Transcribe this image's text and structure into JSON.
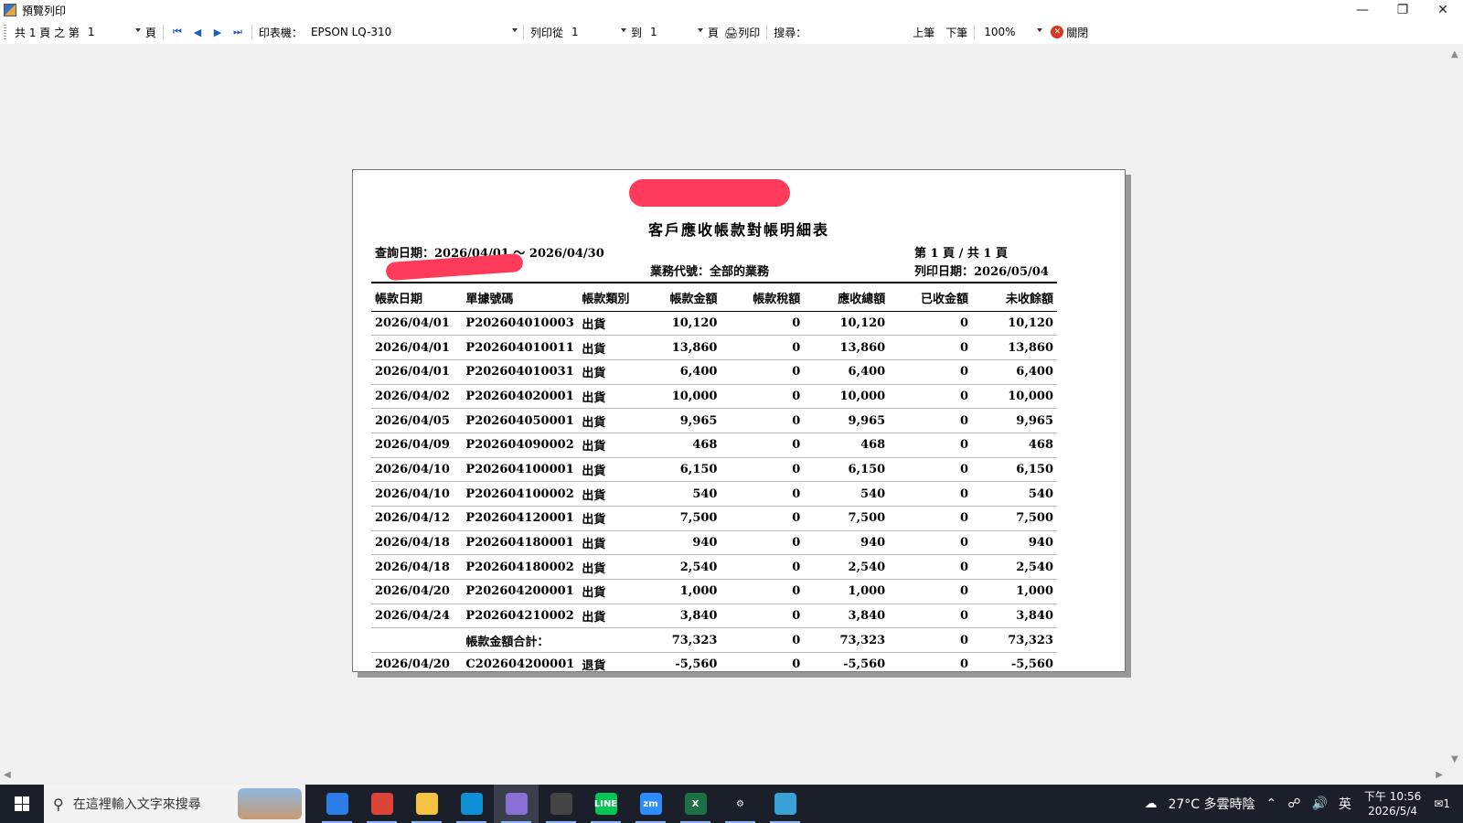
{
  "window": {
    "title": "預覽列印"
  },
  "toolbar": {
    "page_prefix": "共 1 頁 之 第",
    "page_value": "1",
    "page_suffix": "頁",
    "printer_label": "印表機：",
    "printer_value": "EPSON LQ-310",
    "print_from_label": "列印從",
    "print_from_value": "1",
    "to_label": "到",
    "to_value": "1",
    "to_suffix": "頁",
    "print_label": "列印",
    "search_label": "搜尋：",
    "search_value": "",
    "prev_label": "上筆",
    "next_label": "下筆",
    "zoom_value": "100%",
    "close_label": "關閉"
  },
  "report": {
    "title": "客戶應收帳款對帳明細表",
    "query_date": "查詢日期：2026/04/01 ～ 2026/04/30",
    "salesperson": "業務代號：全部的業務",
    "page_info": "第 1 頁 / 共 1 頁",
    "print_date": "列印日期：2026/05/04",
    "columns": [
      "帳款日期",
      "單據號碼",
      "帳款類別",
      "帳款金額",
      "帳款稅額",
      "應收總額",
      "已收金額",
      "未收餘額"
    ],
    "rows": [
      [
        "2026/04/01",
        "P202604010003",
        "出貨",
        "10,120",
        "0",
        "10,120",
        "0",
        "10,120"
      ],
      [
        "2026/04/01",
        "P202604010011",
        "出貨",
        "13,860",
        "0",
        "13,860",
        "0",
        "13,860"
      ],
      [
        "2026/04/01",
        "P202604010031",
        "出貨",
        "6,400",
        "0",
        "6,400",
        "0",
        "6,400"
      ],
      [
        "2026/04/02",
        "P202604020001",
        "出貨",
        "10,000",
        "0",
        "10,000",
        "0",
        "10,000"
      ],
      [
        "2026/04/05",
        "P202604050001",
        "出貨",
        "9,965",
        "0",
        "9,965",
        "0",
        "9,965"
      ],
      [
        "2026/04/09",
        "P202604090002",
        "出貨",
        "468",
        "0",
        "468",
        "0",
        "468"
      ],
      [
        "2026/04/10",
        "P202604100001",
        "出貨",
        "6,150",
        "0",
        "6,150",
        "0",
        "6,150"
      ],
      [
        "2026/04/10",
        "P202604100002",
        "出貨",
        "540",
        "0",
        "540",
        "0",
        "540"
      ],
      [
        "2026/04/12",
        "P202604120001",
        "出貨",
        "7,500",
        "0",
        "7,500",
        "0",
        "7,500"
      ],
      [
        "2026/04/18",
        "P202604180001",
        "出貨",
        "940",
        "0",
        "940",
        "0",
        "940"
      ],
      [
        "2026/04/18",
        "P202604180002",
        "出貨",
        "2,540",
        "0",
        "2,540",
        "0",
        "2,540"
      ],
      [
        "2026/04/20",
        "P202604200001",
        "出貨",
        "1,000",
        "0",
        "1,000",
        "0",
        "1,000"
      ],
      [
        "2026/04/24",
        "P202604210002",
        "出貨",
        "3,840",
        "0",
        "3,840",
        "0",
        "3,840"
      ]
    ],
    "subtotal": {
      "label": "帳款金額合計：",
      "amount": "73,323",
      "tax": "0",
      "total": "73,323",
      "received": "0",
      "balance": "73,323"
    },
    "partial_row": [
      "2026/04/20",
      "C202604200001",
      "退貨",
      "-5,560",
      "0",
      "-5,560",
      "0",
      "-5,560"
    ]
  },
  "taskbar": {
    "search_placeholder": "在這裡輸入文字來搜尋",
    "weather": "27°C 多雲時陰",
    "ime": "英",
    "time": "下午 10:56",
    "date": "2026/5/4",
    "notification_count": "1",
    "apps": [
      {
        "name": "store-icon",
        "label": "",
        "color": "#2b7de9"
      },
      {
        "name": "chrome-icon",
        "label": "",
        "color": "#db4437"
      },
      {
        "name": "file-explorer-icon",
        "label": "",
        "color": "#f5c342"
      },
      {
        "name": "edge-icon",
        "label": "",
        "color": "#0f8fd6"
      },
      {
        "name": "report-app-icon",
        "label": "",
        "color": "#8a6fd6"
      },
      {
        "name": "app-e-icon",
        "label": "",
        "color": "#444"
      },
      {
        "name": "line-icon",
        "label": "LINE",
        "color": "#06c755"
      },
      {
        "name": "zoom-icon",
        "label": "zm",
        "color": "#2d8cff"
      },
      {
        "name": "excel-icon",
        "label": "X",
        "color": "#1d7044"
      },
      {
        "name": "settings-icon",
        "label": "⚙",
        "color": "#1b1f2a"
      },
      {
        "name": "remote-desktop-icon",
        "label": "",
        "color": "#3aa0d8"
      }
    ]
  }
}
